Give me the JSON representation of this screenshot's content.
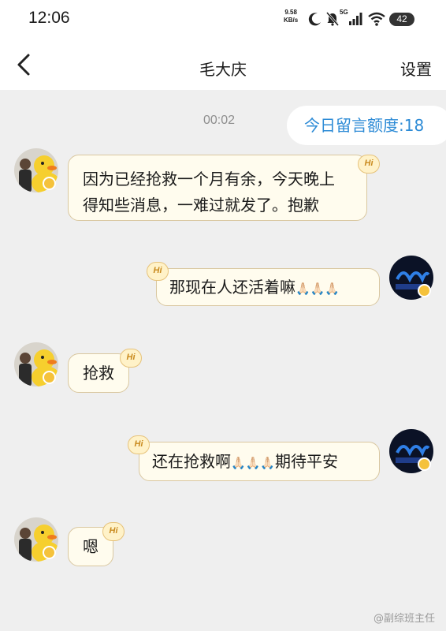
{
  "status_bar": {
    "time": "12:06",
    "net_speed_value": "9.58",
    "net_speed_unit": "KB/s",
    "network": "5G",
    "battery": "42"
  },
  "nav": {
    "back_icon": "chevron-left-icon",
    "title": "毛大庆",
    "settings_label": "设置"
  },
  "chat": {
    "quota_label": "今日留言额度:18",
    "time_marker": "00:02",
    "badge_text": "Hi",
    "messages": [
      {
        "side": "left",
        "lines": [
          "因为已经抢救一个月有余，今天晚上",
          "得知些消息，一难过就发了。抱歉"
        ]
      },
      {
        "side": "right",
        "text": "那现在人还活着嘛",
        "emoji": "🙏🏻🙏🏻🙏🏻"
      },
      {
        "side": "left",
        "text": "抢救"
      },
      {
        "side": "right",
        "text": "还在抢救啊",
        "emoji": "🙏🏻🙏🏻🙏🏻",
        "text_after": "期待平安"
      },
      {
        "side": "left",
        "text": "嗯"
      }
    ]
  },
  "watermark": "@副综班主任",
  "colors": {
    "quota_text": "#2d8bd6",
    "bubble_bg": "#fffcee",
    "bubble_border": "#d9c7a0",
    "chat_bg": "#efefef"
  }
}
